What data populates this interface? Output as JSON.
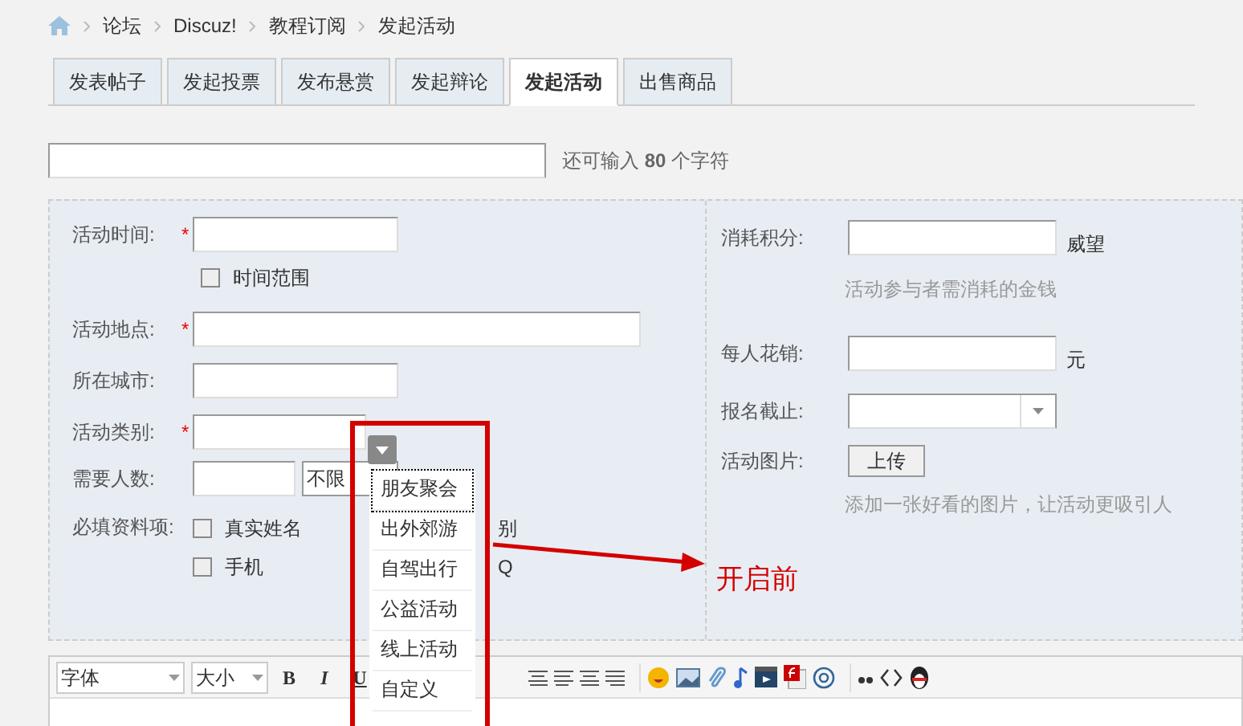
{
  "breadcrumb": [
    "论坛",
    "Discuz!",
    "教程订阅",
    "发起活动"
  ],
  "tabs": [
    {
      "label": "发表帖子",
      "selected": false
    },
    {
      "label": "发起投票",
      "selected": false
    },
    {
      "label": "发布悬赏",
      "selected": false
    },
    {
      "label": "发起辩论",
      "selected": false
    },
    {
      "label": "发起活动",
      "selected": true
    },
    {
      "label": "出售商品",
      "selected": false
    }
  ],
  "title_counter": "还可输入 **80** 个字符",
  "form": {
    "activity_time": {
      "label": "活动时间:",
      "marker": "*",
      "checkbox": {
        "label": "时间范围",
        "checked": false
      }
    },
    "location": {
      "label": "活动地点:",
      "marker": "*"
    },
    "city": {
      "label": "所在城市:"
    },
    "category": {
      "label": "活动类别:",
      "marker": "*"
    },
    "headcount": {
      "label": "需要人数:",
      "select_value": "不限"
    },
    "required_info": {
      "label": "必填资料项:",
      "options": [
        {
          "label": "真实姓名",
          "checked": false
        },
        {
          "label": "手机",
          "checked": false
        }
      ],
      "covered_labels": [
        "别",
        "Q"
      ]
    },
    "credits": {
      "label": "消耗积分:",
      "unit": "威望",
      "hint": "活动参与者需消耗的金钱"
    },
    "cost": {
      "label": "每人花销:",
      "unit": "元"
    },
    "deadline": {
      "label": "报名截止:"
    },
    "image": {
      "label": "活动图片:",
      "button": "上传",
      "hint": "添加一张好看的图片，让活动更吸引人"
    }
  },
  "editor": {
    "font_select": "字体",
    "size_select": "大小",
    "format_buttons": [
      "B",
      "I",
      "U"
    ]
  },
  "category_dropdown": {
    "options": [
      {
        "label": "朋友聚会",
        "selected": true
      },
      {
        "label": "出外郊游",
        "selected": false
      },
      {
        "label": "自驾出行",
        "selected": false
      },
      {
        "label": "公益活动",
        "selected": false
      },
      {
        "label": "线上活动",
        "selected": false
      },
      {
        "label": "自定义",
        "selected": false
      }
    ]
  },
  "annotation": {
    "text": "开启前"
  }
}
